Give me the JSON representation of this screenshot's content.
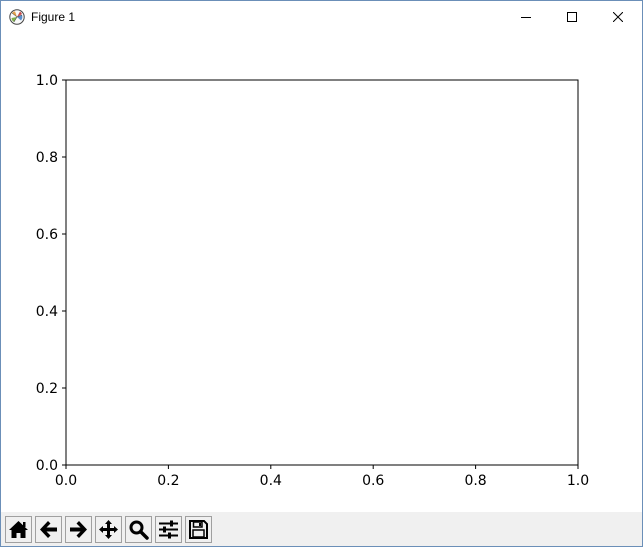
{
  "window": {
    "title": "Figure 1",
    "controls": [
      "minimize",
      "maximize",
      "close"
    ]
  },
  "chart_data": {
    "type": "line",
    "title": "",
    "xlabel": "",
    "ylabel": "",
    "series": [],
    "xlim": [
      0.0,
      1.0
    ],
    "ylim": [
      0.0,
      1.0
    ],
    "xticks": [
      "0.0",
      "0.2",
      "0.4",
      "0.6",
      "0.8",
      "1.0"
    ],
    "yticks": [
      "0.0",
      "0.2",
      "0.4",
      "0.6",
      "0.8",
      "1.0"
    ],
    "grid": false
  },
  "toolbar": {
    "buttons": [
      "home-icon",
      "back-arrow-icon",
      "forward-arrow-icon",
      "pan-move-icon",
      "zoom-magnifier-icon",
      "subplots-sliders-icon",
      "save-floppy-icon"
    ]
  },
  "colors": {
    "window_border": "#6b8fb8",
    "toolbar_bg": "#f0f0f0",
    "axes": "#000000"
  }
}
